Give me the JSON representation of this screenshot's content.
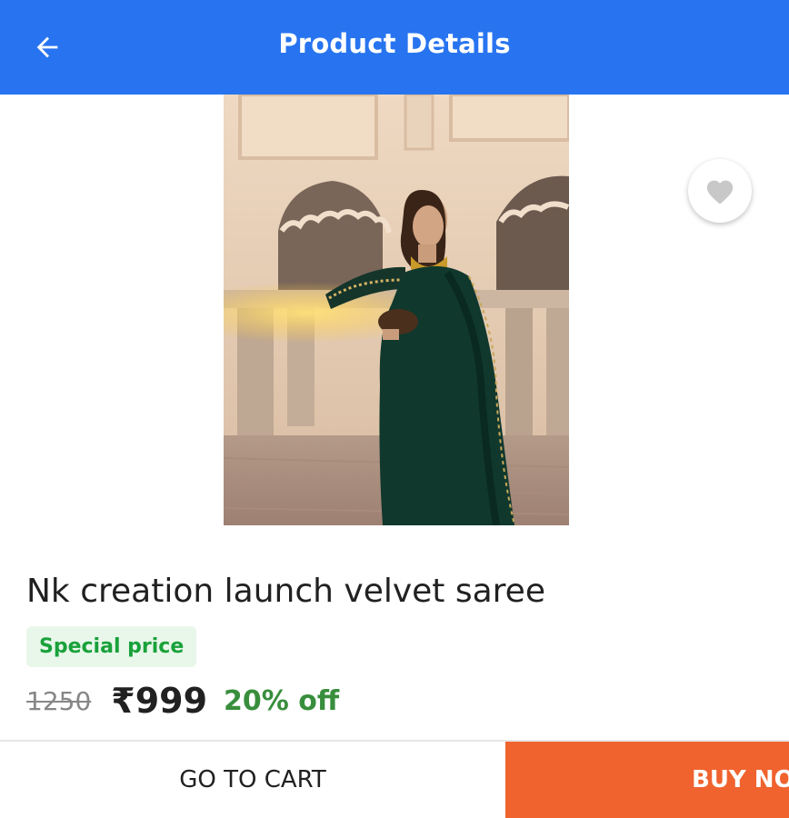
{
  "header": {
    "title": "Product Details",
    "back_icon": "arrow-left-icon",
    "background": "#2874f0"
  },
  "product": {
    "image_icon": "product-photo",
    "wishlist_icon": "heart-icon",
    "name": "Nk creation launch velvet saree",
    "badge": "Special price",
    "mrp": "1250",
    "price": "₹999",
    "discount": "20% off"
  },
  "actions": {
    "go_to_cart": "GO TO CART",
    "buy_now": "BUY NO",
    "buy_color": "#f0632e"
  }
}
